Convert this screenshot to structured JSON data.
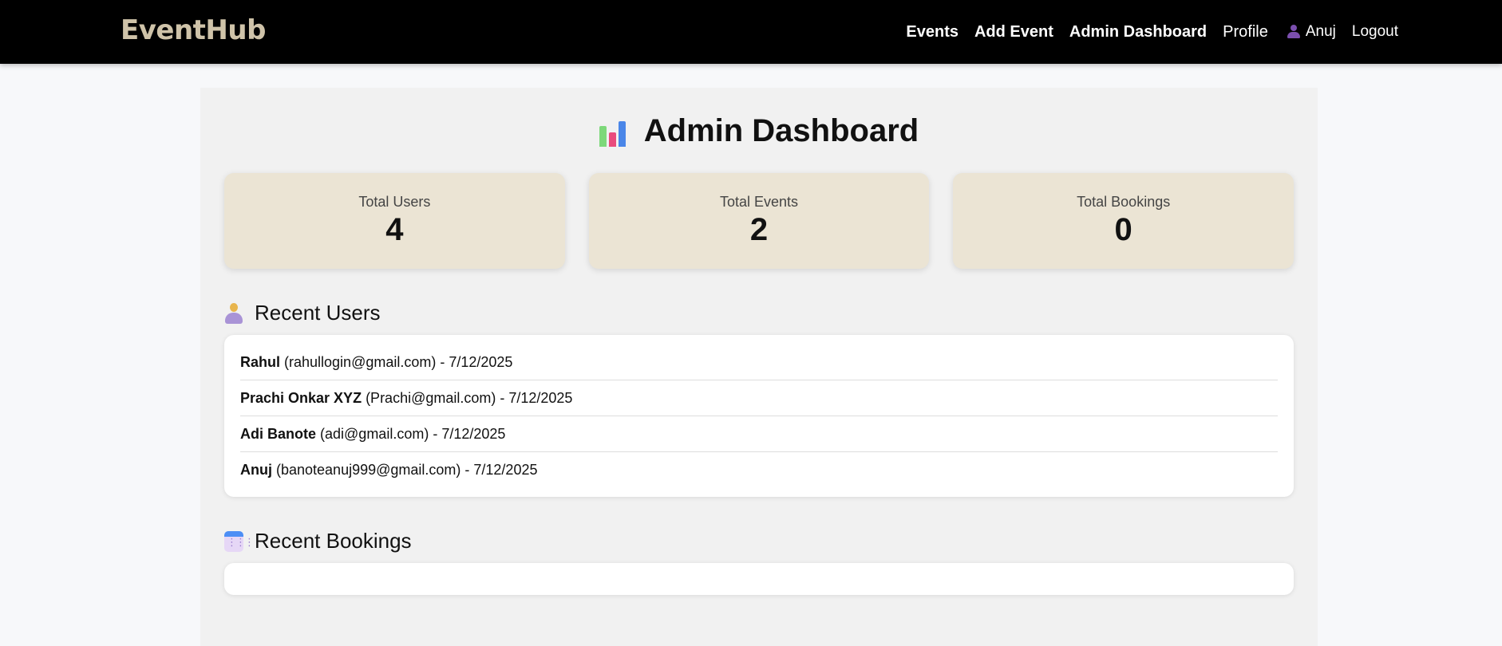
{
  "navbar": {
    "logo": "EventHub",
    "links": [
      "Events",
      "Add Event",
      "Admin Dashboard",
      "Profile"
    ],
    "user_name": "Anuj",
    "logout": "Logout"
  },
  "page": {
    "title": "Admin Dashboard"
  },
  "stats": [
    {
      "label": "Total Users",
      "value": "4"
    },
    {
      "label": "Total Events",
      "value": "2"
    },
    {
      "label": "Total Bookings",
      "value": "0"
    }
  ],
  "recent_users": {
    "title": "Recent Users",
    "items": [
      {
        "name": "Rahul",
        "detail": " (rahullogin@gmail.com) - 7/12/2025"
      },
      {
        "name": "Prachi Onkar XYZ",
        "detail": " (Prachi@gmail.com) - 7/12/2025"
      },
      {
        "name": "Adi Banote",
        "detail": " (adi@gmail.com) - 7/12/2025"
      },
      {
        "name": "Anuj",
        "detail": " (banoteanuj999@gmail.com) - 7/12/2025"
      }
    ]
  },
  "recent_bookings": {
    "title": "Recent Bookings"
  },
  "colors": {
    "navbar_bg": "#000000",
    "logo": "#cfc3a9",
    "stat_card_bg": "#ebe4d4",
    "container_bg": "#f1f1f1"
  }
}
